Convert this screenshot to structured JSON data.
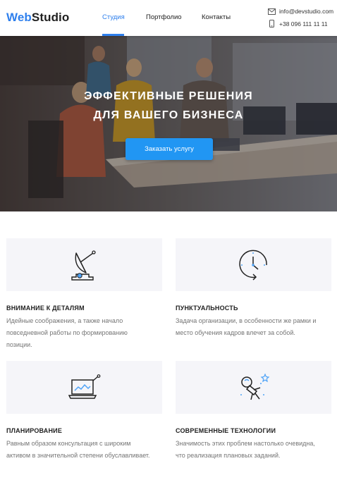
{
  "header": {
    "logo_part1": "Web",
    "logo_part2": "Studio",
    "nav": [
      "Студия",
      "Портфолио",
      "Контакты"
    ],
    "email": "info@devstudio.com",
    "phone": "+38 096 111 11 11",
    "accent_color": "#2f80ed"
  },
  "hero": {
    "title_line1": "ЭФФЕКТИВНЫЕ РЕШЕНИЯ",
    "title_line2": "ДЛЯ ВАШЕГО БИЗНЕСА",
    "button_label": "Заказать услугу",
    "button_color": "#2196f3"
  },
  "features": [
    {
      "icon": "satellite-dish-icon",
      "title": "ВНИМАНИЕ К ДЕТАЛЯМ",
      "text": [
        "Идейные соображения, а также начало",
        "повседневной работы по формированию",
        "позиции."
      ]
    },
    {
      "icon": "clock-icon",
      "title": "ПУНКТУАЛЬНОСТЬ",
      "text": [
        "Задача организации, в особенности же рамки и",
        "место обучения кадров влечет за собой."
      ]
    },
    {
      "icon": "laptop-chart-icon",
      "title": "ПЛАНИРОВАНИЕ",
      "text": [
        "Равным образом консультация с широким",
        "активом в значительной степени обуславливает."
      ]
    },
    {
      "icon": "astronaut-icon",
      "title": "СОВРЕМЕННЫЕ ТЕХНОЛОГИИ",
      "text": [
        "Значимость этих проблем настолько очевидна,",
        "что реализация плановых заданий."
      ]
    }
  ]
}
